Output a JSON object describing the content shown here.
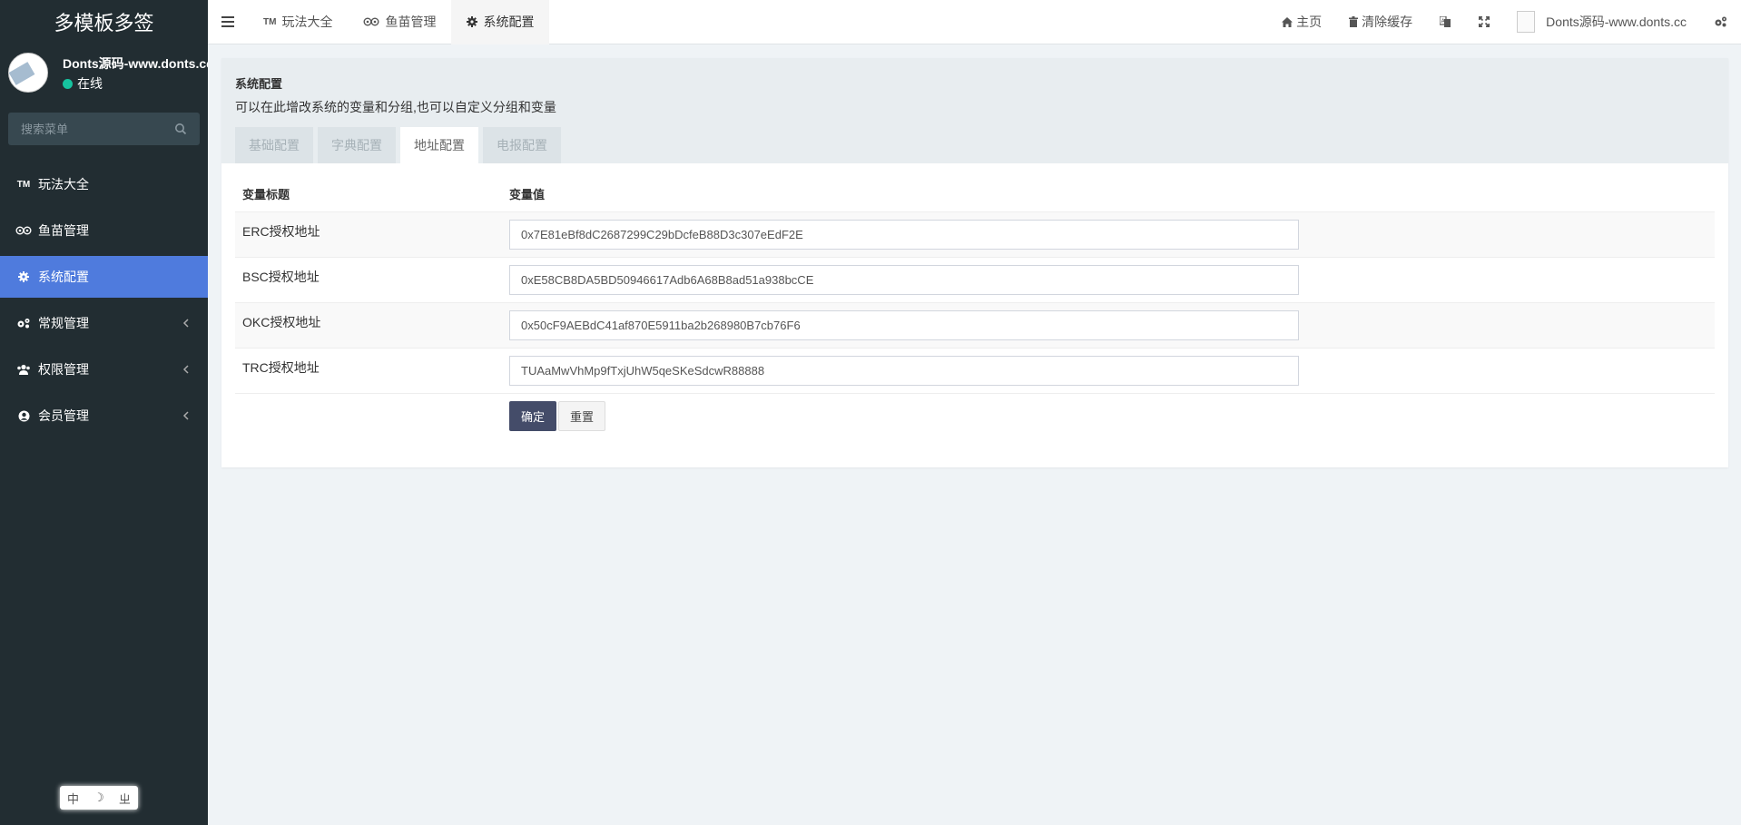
{
  "sidebar": {
    "brand": "多模板多签",
    "user": {
      "name": "Donts源码-www.donts.cc",
      "status": "在线"
    },
    "search_placeholder": "搜索菜单",
    "items": [
      {
        "label": "玩法大全",
        "icon": "trademark-icon"
      },
      {
        "label": "鱼苗管理",
        "icon": "tripadvisor-icon"
      },
      {
        "label": "系统配置",
        "icon": "gear-icon",
        "active": true
      },
      {
        "label": "常规管理",
        "icon": "gears-icon"
      },
      {
        "label": "权限管理",
        "icon": "users-icon"
      },
      {
        "label": "会员管理",
        "icon": "user-circle-icon"
      }
    ],
    "lang": [
      "中",
      "☽",
      "ㄓ"
    ]
  },
  "navbar": {
    "tabs": [
      {
        "label": "玩法大全"
      },
      {
        "label": "鱼苗管理"
      },
      {
        "label": "系统配置",
        "active": true
      }
    ],
    "home": "主页",
    "clear_cache": "清除缓存",
    "user_name": "Donts源码-www.donts.cc"
  },
  "panel": {
    "title": "系统配置",
    "description": "可以在此增改系统的变量和分组,也可以自定义分组和变量",
    "tabs": [
      "基础配置",
      "字典配置",
      "地址配置",
      "电报配置"
    ],
    "active_tab": 2,
    "table": {
      "col_title": "变量标题",
      "col_value": "变量值",
      "rows": [
        {
          "title": "ERC授权地址",
          "value": "0x7E81eBf8dC2687299C29bDcfeB88D3c307eEdF2E"
        },
        {
          "title": "BSC授权地址",
          "value": "0xE58CB8DA5BD50946617Adb6A68B8ad51a938bcCE"
        },
        {
          "title": "OKC授权地址",
          "value": "0x50cF9AEBdC41af870E5911ba2b268980B7cb76F6"
        },
        {
          "title": "TRC授权地址",
          "value": "TUAaMwVhMp9fTxjUhW5qeSKeSdcwR88888"
        }
      ]
    },
    "confirm": "确定",
    "reset": "重置"
  },
  "colors": {
    "sidebar_bg": "#222d32",
    "active": "#4f7bdd",
    "primary_btn": "#444c69",
    "status_online": "#16c39f"
  }
}
